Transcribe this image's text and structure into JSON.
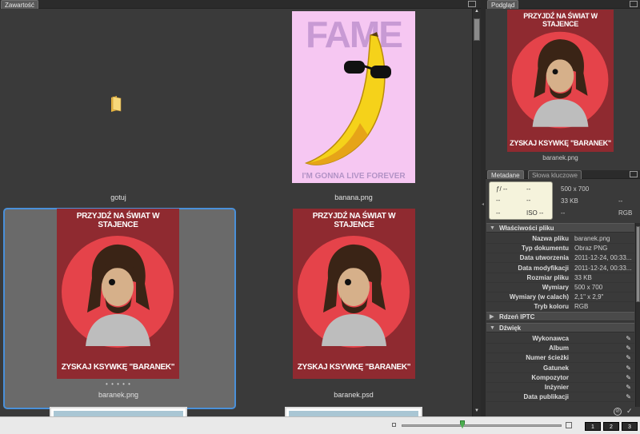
{
  "content_panel": {
    "tab_label": "Zawartość",
    "items": [
      {
        "caption": "gotuj",
        "kind": "folder"
      },
      {
        "caption": "banana.png",
        "kind": "image",
        "poster_top": "FAME",
        "poster_bottom": "I'M GONNA LIVE FOREVER"
      },
      {
        "caption": "baranek.png",
        "kind": "image",
        "selected": true,
        "rating_dots": "• • • • •",
        "poster_top": "PRZYJDŹ NA ŚWIAT W STAJENCE",
        "poster_bottom": "ZYSKAJ KSYWKĘ \"BARANEK\""
      },
      {
        "caption": "baranek.psd",
        "kind": "image",
        "poster_top": "PRZYJDŹ NA ŚWIAT W STAJENCE",
        "poster_bottom": "ZYSKAJ KSYWKĘ \"BARANEK\""
      }
    ]
  },
  "preview_panel": {
    "tab_label": "Podgląd",
    "filename": "baranek.png",
    "poster_top": "PRZYJDŹ NA ŚWIAT W STAJENCE",
    "poster_bottom": "ZYSKAJ KSYWKĘ \"BARANEK\""
  },
  "metadata_panel": {
    "tabs": [
      "Metadane",
      "Słowa kluczowe"
    ],
    "camera": {
      "fstop": "ƒ/ --",
      "shutter": "--",
      "c1": "--",
      "c2": "--",
      "c3": "--",
      "iso": "ISO --"
    },
    "summary": {
      "dimensions": "500 x 700",
      "size": "33 KB",
      "dash1": "--",
      "dash2": "--",
      "mode": "RGB"
    },
    "sections": {
      "file_props": "Właściwości pliku",
      "iptc": "Rdzeń IPTC",
      "audio": "Dźwięk"
    },
    "file_rows": [
      {
        "k": "Nazwa pliku",
        "v": "baranek.png"
      },
      {
        "k": "Typ dokumentu",
        "v": "Obraz PNG"
      },
      {
        "k": "Data utworzenia",
        "v": "2011-12-24, 00:33..."
      },
      {
        "k": "Data modyfikacji",
        "v": "2011-12-24, 00:33..."
      },
      {
        "k": "Rozmiar pliku",
        "v": "33 KB"
      },
      {
        "k": "Wymiary",
        "v": "500 x 700"
      },
      {
        "k": "Wymiary (w calach)",
        "v": "2,1\" x 2,9\""
      },
      {
        "k": "Tryb koloru",
        "v": "RGB"
      }
    ],
    "audio_rows": [
      "Wykonawca",
      "Album",
      "Numer ścieżki",
      "Gatunek",
      "Kompozytor",
      "Inżynier",
      "Data publikacji"
    ]
  },
  "bottom_bar": {
    "zoom_fraction": 0.38,
    "views": [
      "1",
      "2",
      "3"
    ]
  },
  "colors": {
    "accent": "#4a90d9",
    "poster_red": "#8f2a30",
    "circle_red": "#e5434a",
    "banana_bg": "#f4c6f0"
  }
}
